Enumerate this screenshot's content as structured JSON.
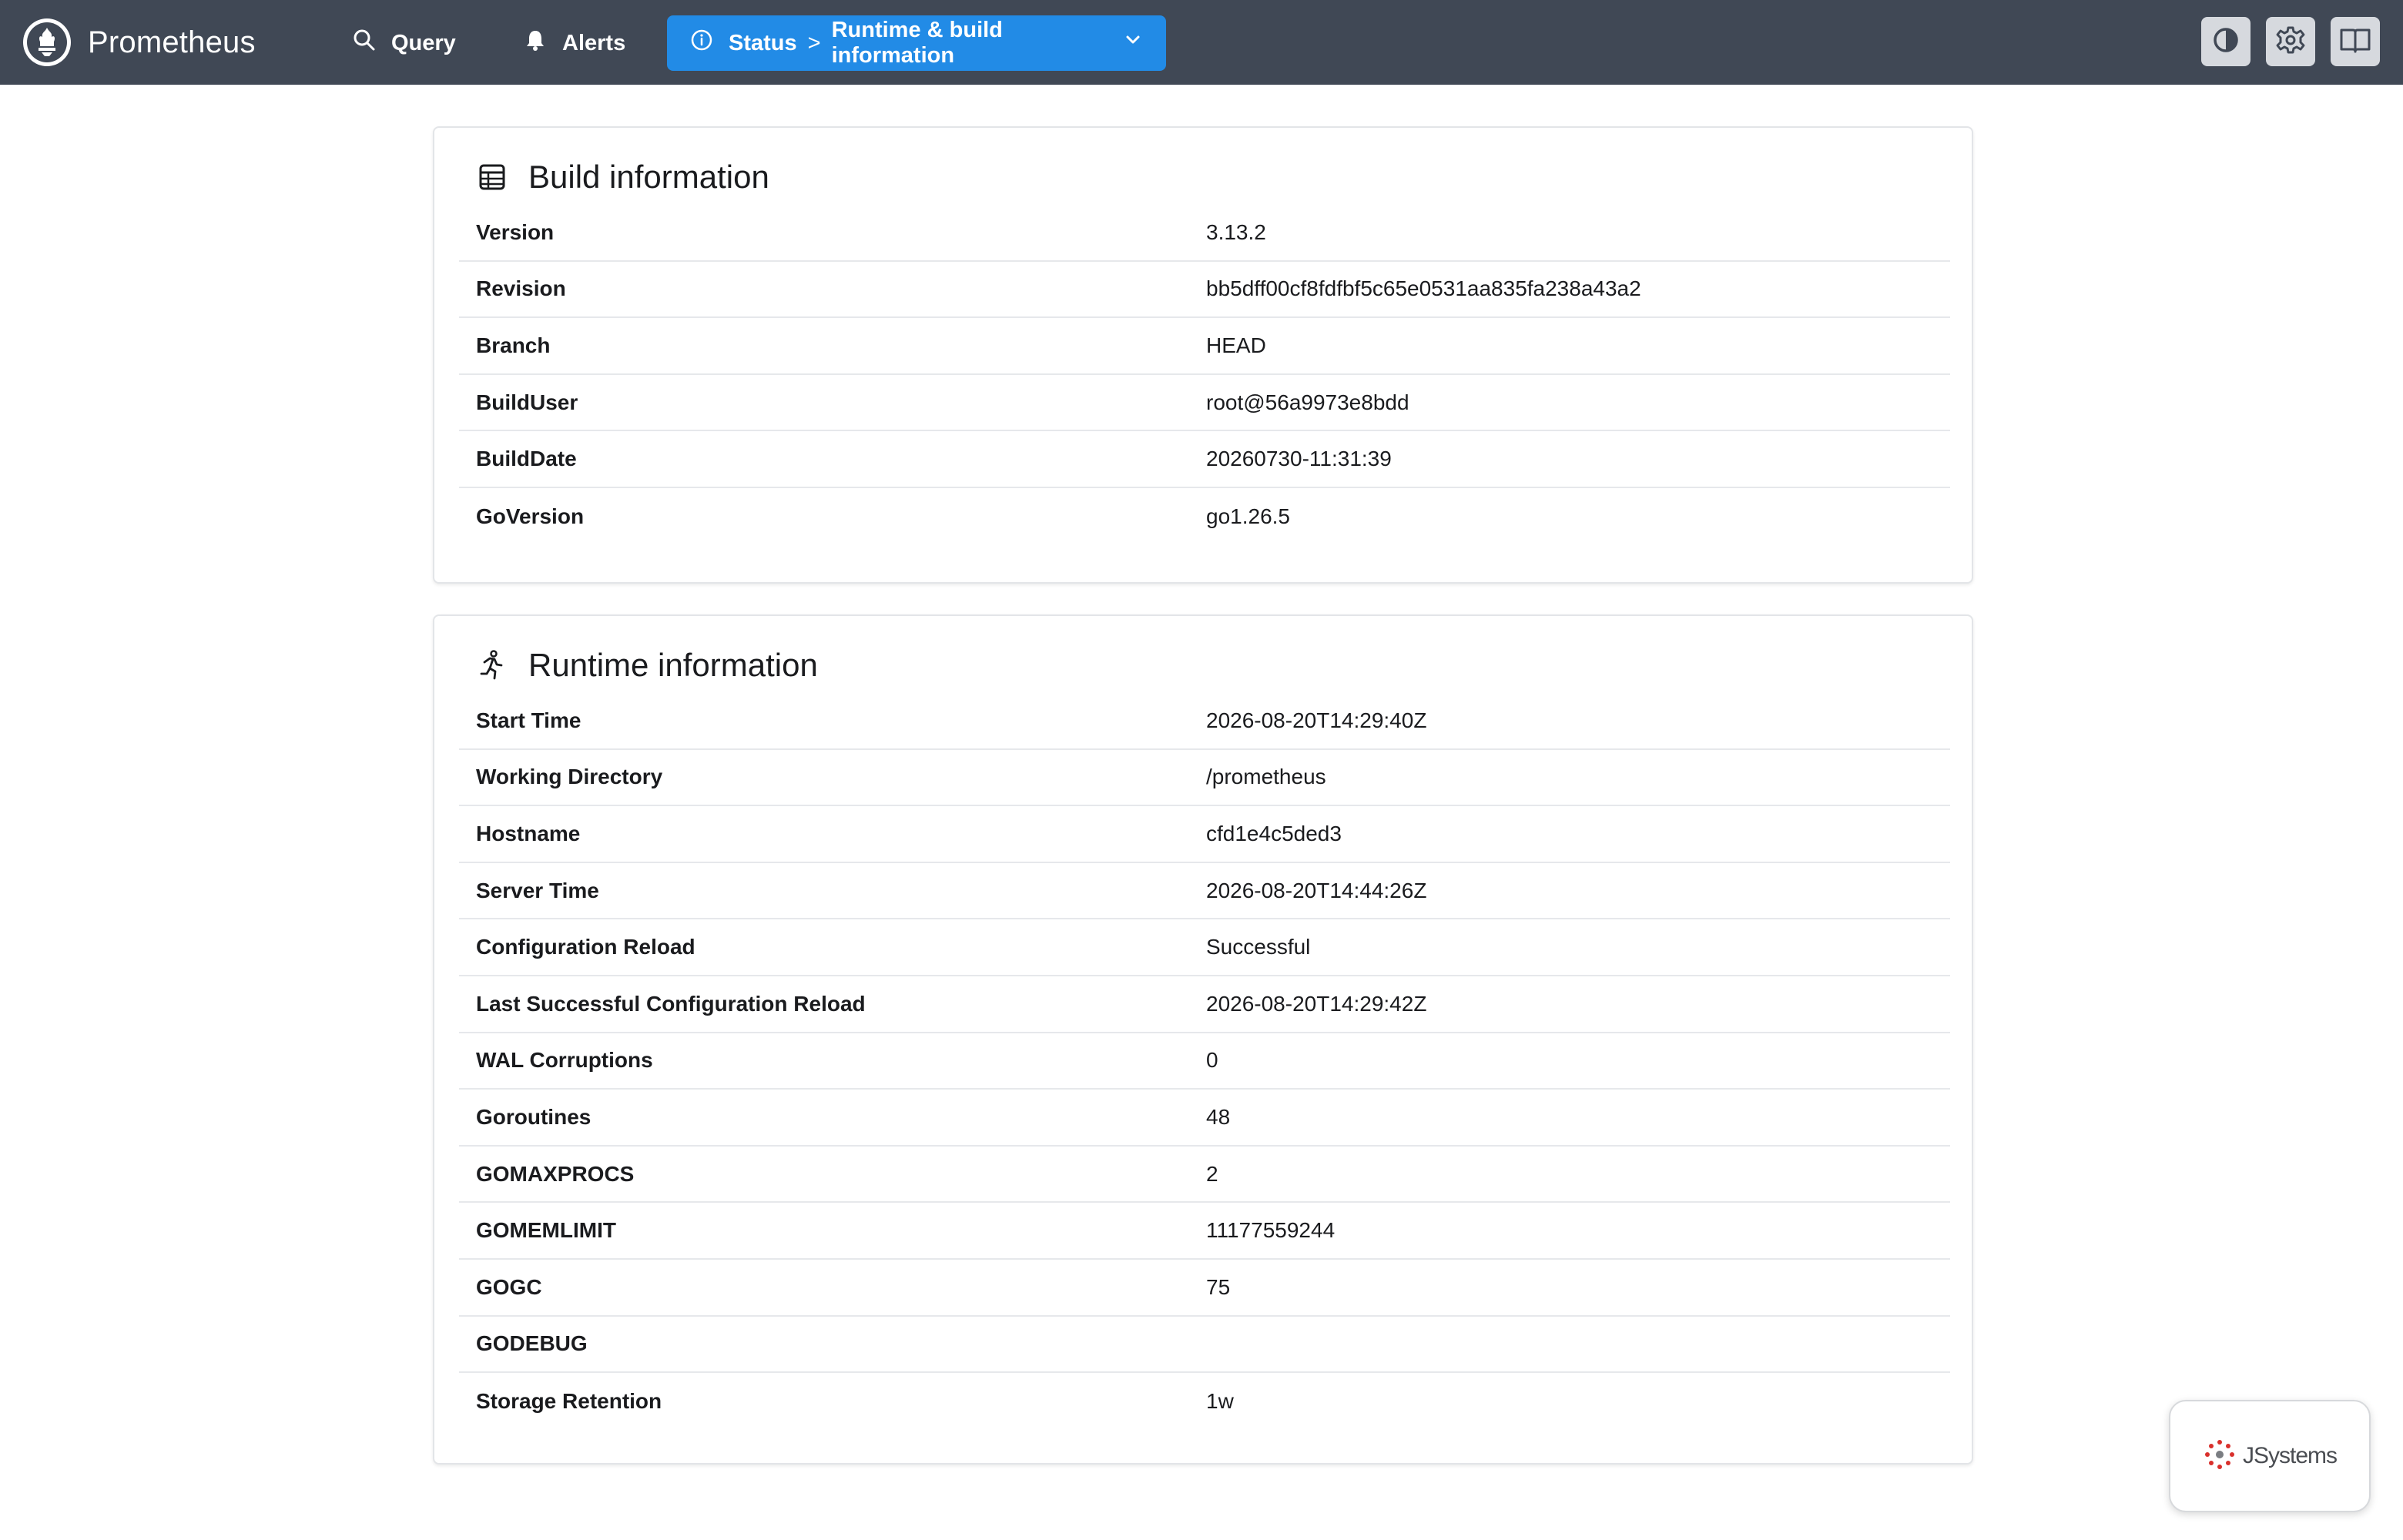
{
  "header": {
    "brand": "Prometheus",
    "nav": {
      "query": "Query",
      "alerts": "Alerts",
      "status_section": "Status",
      "status_separator": ">",
      "status_page": "Runtime & build information"
    },
    "actions": [
      "theme-toggle-icon",
      "settings-gear-icon",
      "documentation-book-icon"
    ]
  },
  "build": {
    "title": "Build information",
    "rows": [
      {
        "label": "Version",
        "value": "3.13.2"
      },
      {
        "label": "Revision",
        "value": "bb5dff00cf8fdfbf5c65e0531aa835fa238a43a2"
      },
      {
        "label": "Branch",
        "value": "HEAD"
      },
      {
        "label": "BuildUser",
        "value": "root@56a9973e8bdd"
      },
      {
        "label": "BuildDate",
        "value": "20260730-11:31:39"
      },
      {
        "label": "GoVersion",
        "value": "go1.26.5"
      }
    ]
  },
  "runtime": {
    "title": "Runtime information",
    "rows": [
      {
        "label": "Start Time",
        "value": "2026-08-20T14:29:40Z"
      },
      {
        "label": "Working Directory",
        "value": "/prometheus"
      },
      {
        "label": "Hostname",
        "value": "cfd1e4c5ded3"
      },
      {
        "label": "Server Time",
        "value": "2026-08-20T14:44:26Z"
      },
      {
        "label": "Configuration Reload",
        "value": "Successful"
      },
      {
        "label": "Last Successful Configuration Reload",
        "value": "2026-08-20T14:29:42Z"
      },
      {
        "label": "WAL Corruptions",
        "value": "0"
      },
      {
        "label": "Goroutines",
        "value": "48"
      },
      {
        "label": "GOMAXPROCS",
        "value": "2"
      },
      {
        "label": "GOMEMLIMIT",
        "value": "11177559244"
      },
      {
        "label": "GOGC",
        "value": "75"
      },
      {
        "label": "GODEBUG",
        "value": ""
      },
      {
        "label": "Storage Retention",
        "value": "1w"
      }
    ]
  },
  "watermark": {
    "text": "JSystems"
  },
  "colors": {
    "header_bg": "#404855",
    "active_nav": "#228be6",
    "border": "#e3e5e8"
  }
}
